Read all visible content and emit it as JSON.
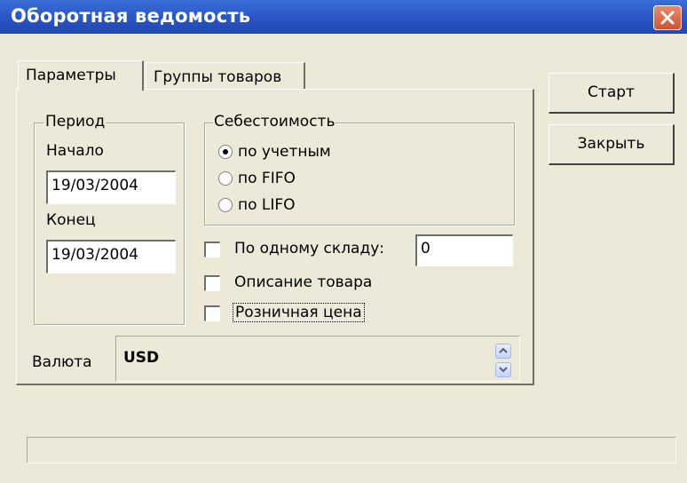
{
  "window": {
    "title": "Оборотная ведомость"
  },
  "tabs": [
    {
      "label": "Параметры",
      "active": true
    },
    {
      "label": "Группы товаров",
      "active": false
    }
  ],
  "period": {
    "group_label": "Период",
    "start_label": "Начало",
    "start_value": "19/03/2004",
    "end_label": "Конец",
    "end_value": "19/03/2004"
  },
  "cost": {
    "group_label": "Себестоимость",
    "options": [
      {
        "label": "по учетным",
        "selected": true
      },
      {
        "label": "по FIFO",
        "selected": false
      },
      {
        "label": "по LIFO",
        "selected": false
      }
    ]
  },
  "checks": {
    "single_warehouse_label": "По одному складу:",
    "single_warehouse_value": "0",
    "description_label": "Описание товара",
    "retail_price_label": "Розничная цена"
  },
  "currency": {
    "label": "Валюта",
    "value": "USD"
  },
  "buttons": {
    "start_label": "Старт",
    "close_label": "Закрыть"
  },
  "colors": {
    "titlebar": "#2a55c4",
    "close_button": "#d4512f",
    "dialog_bg": "#ece9d8"
  }
}
